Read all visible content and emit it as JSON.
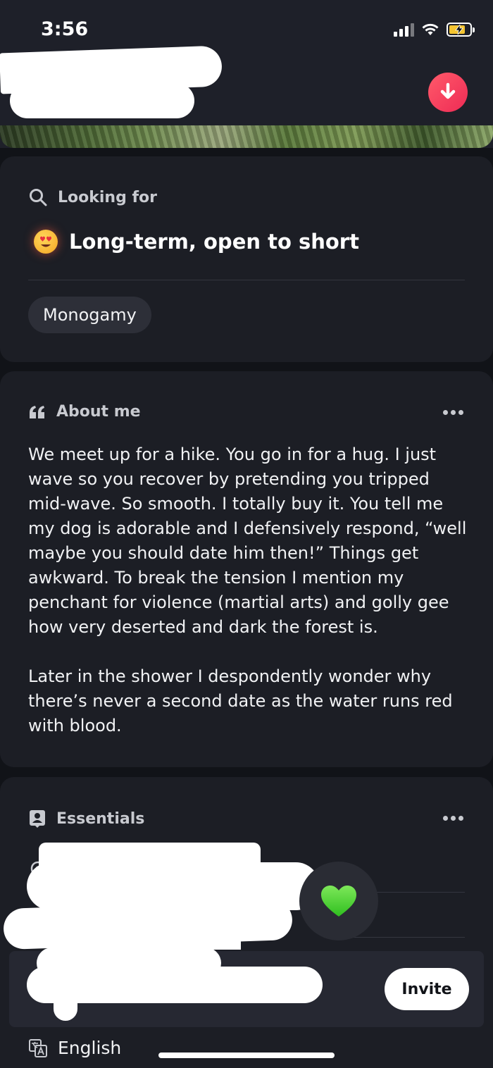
{
  "status_bar": {
    "time": "3:56"
  },
  "looking_for": {
    "label": "Looking for",
    "value": "Long-term, open to short",
    "tag": "Monogamy"
  },
  "about_me": {
    "label": "About me",
    "text": "We meet up for a hike. You go in for a hug. I just wave so you recover by pretending you tripped mid-wave. So smooth. I totally buy it. You tell me my dog is adorable and I defensively respond, “well maybe you should date him then!” Things get awkward. To break the tension I mention my penchant for violence (martial arts) and golly gee how very deserted and dark the forest is.\n\nLater in the shower I despondently wonder why there’s never a second date as the water runs red with blood."
  },
  "essentials": {
    "label": "Essentials"
  },
  "invite_bar": {
    "button_label": "Invite"
  },
  "language": {
    "value": "English"
  },
  "icons": {
    "download": "arrow-down-icon",
    "search": "search-icon",
    "emoji": "heart-eyes-emoji-icon",
    "quote": "quote-icon",
    "more": "more-dots-icon",
    "essentials": "person-card-icon",
    "location": "location-pin-icon",
    "like": "green-heart-icon",
    "language": "translate-icon"
  },
  "colors": {
    "download_button": "#ee2b55",
    "heart": "#44d62c",
    "card_bg": "#1c1e25",
    "page_bg": "#111318"
  }
}
